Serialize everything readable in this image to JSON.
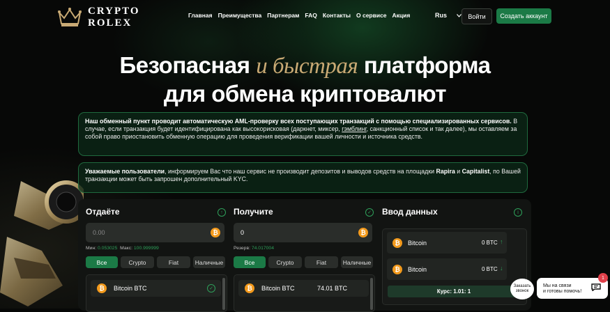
{
  "header": {
    "logo_line1": "CRYPTO",
    "logo_line2": "ROLEX",
    "nav": [
      "Главная",
      "Преимущества",
      "Партнерам",
      "FAQ",
      "Контакты",
      "О сервисе",
      "Акция"
    ],
    "lang": "Rus",
    "login_label": "Войти",
    "signup_label": "Создать аккаунт"
  },
  "hero": {
    "line1_start": "Безопасная ",
    "line1_accent": "и быстрая",
    "line1_end": " платформа",
    "line2": "для обмена криптовалют"
  },
  "notices": {
    "aml_bold": "Наш обменный пункт проводит автоматическую AML-проверку всех поступающих транзакций с помощью специализированных сервисов.",
    "aml_text_a": " В случае, если транзакция будет идентифицирована как высокорисковая (даркнет, миксер, ",
    "aml_link": "гэмблинг",
    "aml_text_b": ", санкционный список и так далее), мы оставляем за собой право приостановить обменную операцию для проведения верификации вашей личности и источника средств.",
    "users_bold": "Уважаемые пользователи",
    "users_text_a": ", информируем Вас что наш сервис не производит депозитов и выводов средств на площадки ",
    "users_bold2": "Rapira",
    "users_and": " и ",
    "users_bold3": "Capitalist",
    "users_text_b": ", по Вашей транзакции может быть запрошен дополнительный KYC."
  },
  "exchange": {
    "give": {
      "title": "Отдаёте",
      "amount_placeholder": "0.00",
      "min_label": "Мин:",
      "min_value": "0.053025",
      "max_label": "Макс:",
      "max_value": "100.999999",
      "filters": [
        "Все",
        "Crypto",
        "Fiat",
        "Наличные"
      ],
      "selected_coin": "Bitcoin BTC"
    },
    "receive": {
      "title": "Получите",
      "amount_value": "0",
      "reserve_label": "Резерв:",
      "reserve_value": "74.017004",
      "filters": [
        "Все",
        "Crypto",
        "Fiat",
        "Наличные"
      ],
      "coin_name": "Bitcoin BTC",
      "coin_amount": "74.01 BTC"
    },
    "data": {
      "title": "Ввод данных",
      "rows": [
        {
          "name": "Bitcoin",
          "amount": "0 BTC"
        },
        {
          "name": "Bitcoin",
          "amount": "0 BTC"
        }
      ],
      "rate": "Курс: 1.01: 1"
    }
  },
  "widgets": {
    "callback_line1": "Заказать",
    "callback_line2": "звонок",
    "chat_line1": "Мы на связи",
    "chat_line2": "и готовы помочь!",
    "chat_badge": "1"
  },
  "colors": {
    "accent_green": "#1b7a46",
    "gold": "#c9aa74",
    "bitcoin": "#f39a1c"
  }
}
